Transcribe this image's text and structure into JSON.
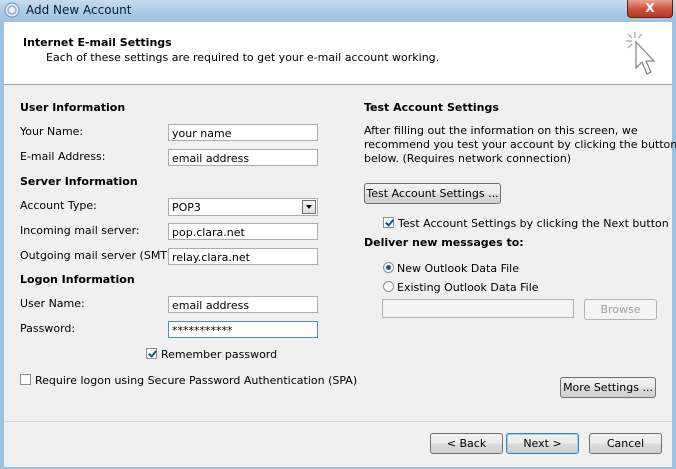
{
  "window": {
    "title": "Add New Account",
    "close_symbol": "X"
  },
  "header": {
    "title": "Internet E-mail Settings",
    "subtitle": "Each of these settings are required to get your e-mail account working."
  },
  "user_information": {
    "heading": "User Information",
    "name_label": "Your Name:",
    "name_value": "your name",
    "email_label": "E-mail Address:",
    "email_value": "email address"
  },
  "server_information": {
    "heading": "Server Information",
    "account_type_label": "Account Type:",
    "account_type_value": "POP3",
    "incoming_label": "Incoming mail server:",
    "incoming_value": "pop.clara.net",
    "outgoing_label": "Outgoing mail server (SMTP):",
    "outgoing_value": "relay.clara.net"
  },
  "logon_information": {
    "heading": "Logon Information",
    "username_label": "User Name:",
    "username_value": "email address",
    "password_label": "Password:",
    "password_value": "***********",
    "remember_label": "Remember password",
    "remember_checked": true,
    "spa_label": "Require logon using Secure Password Authentication (SPA)",
    "spa_checked": false
  },
  "test_settings": {
    "heading": "Test Account Settings",
    "description": [
      "After filling out the information on this screen, we",
      "recommend you test your account by clicking the button",
      "below. (Requires network connection)"
    ],
    "test_button": "Test Account Settings ...",
    "auto_test_label": "Test Account Settings by clicking the Next button",
    "auto_test_checked": true
  },
  "deliver": {
    "heading": "Deliver new messages to:",
    "option_new": "New Outlook Data File",
    "option_existing": "Existing Outlook Data File",
    "selected": "new",
    "existing_path": "",
    "browse_button": "Browse"
  },
  "buttons": {
    "more_settings": "More Settings ...",
    "back": "< Back",
    "next": "Next >",
    "cancel": "Cancel"
  }
}
